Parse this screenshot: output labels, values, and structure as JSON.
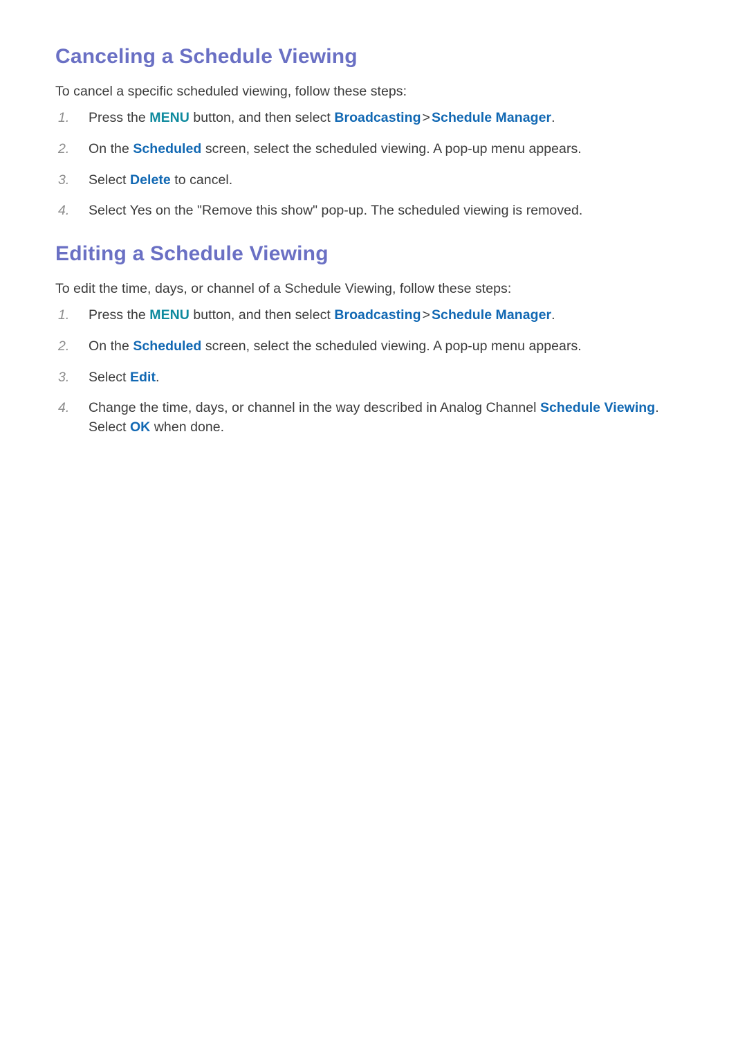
{
  "colors": {
    "heading": "#6a70c4",
    "body_text": "#3a3a3a",
    "keyword_menu": "#0e8a9e",
    "keyword_link": "#1168b3",
    "list_number": "#8c8c8c",
    "page_background": "#ffffff"
  },
  "sections": [
    {
      "id": "canceling-a-schedule-viewing",
      "heading": "Canceling a Schedule Viewing",
      "intro": "To cancel a specific scheduled viewing, follow these steps:",
      "steps": [
        {
          "number": "1.",
          "parts": [
            {
              "text": "Press the ",
              "style": "plain"
            },
            {
              "text": "MENU",
              "style": "menu"
            },
            {
              "text": " button, and then select ",
              "style": "plain"
            },
            {
              "text": "Broadcasting",
              "style": "link"
            },
            {
              "text": ">",
              "style": "separator"
            },
            {
              "text": "Schedule Manager",
              "style": "link"
            },
            {
              "text": ".",
              "style": "plain"
            }
          ]
        },
        {
          "number": "2.",
          "parts": [
            {
              "text": "On the ",
              "style": "plain"
            },
            {
              "text": "Scheduled",
              "style": "link"
            },
            {
              "text": " screen, select the scheduled viewing. A pop-up menu appears.",
              "style": "plain"
            }
          ]
        },
        {
          "number": "3.",
          "parts": [
            {
              "text": "Select ",
              "style": "plain"
            },
            {
              "text": "Delete",
              "style": "link"
            },
            {
              "text": " to cancel.",
              "style": "plain"
            }
          ]
        },
        {
          "number": "4.",
          "parts": [
            {
              "text": "Select Yes on the \"Remove this show\" pop-up. The scheduled viewing is removed.",
              "style": "plain"
            }
          ]
        }
      ]
    },
    {
      "id": "editing-a-schedule-viewing",
      "heading": "Editing a Schedule Viewing",
      "intro": "To edit the time, days, or channel of a Schedule Viewing, follow these steps:",
      "steps": [
        {
          "number": "1.",
          "parts": [
            {
              "text": "Press the ",
              "style": "plain"
            },
            {
              "text": "MENU",
              "style": "menu"
            },
            {
              "text": " button, and then select ",
              "style": "plain"
            },
            {
              "text": "Broadcasting",
              "style": "link"
            },
            {
              "text": ">",
              "style": "separator"
            },
            {
              "text": "Schedule Manager",
              "style": "link"
            },
            {
              "text": ".",
              "style": "plain"
            }
          ]
        },
        {
          "number": "2.",
          "parts": [
            {
              "text": "On the ",
              "style": "plain"
            },
            {
              "text": "Scheduled",
              "style": "link"
            },
            {
              "text": " screen, select the scheduled viewing. A pop-up menu appears.",
              "style": "plain"
            }
          ]
        },
        {
          "number": "3.",
          "parts": [
            {
              "text": "Select ",
              "style": "plain"
            },
            {
              "text": "Edit",
              "style": "link"
            },
            {
              "text": ".",
              "style": "plain"
            }
          ]
        },
        {
          "number": "4.",
          "parts": [
            {
              "text": "Change the time, days, or channel in the way described in Analog Channel ",
              "style": "plain"
            },
            {
              "text": "Schedule Viewing",
              "style": "link"
            },
            {
              "text": ". Select ",
              "style": "plain"
            },
            {
              "text": "OK",
              "style": "link"
            },
            {
              "text": " when done.",
              "style": "plain"
            }
          ]
        }
      ]
    }
  ]
}
